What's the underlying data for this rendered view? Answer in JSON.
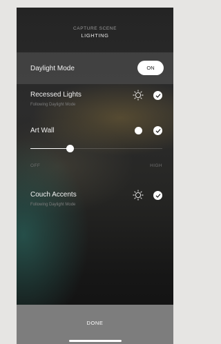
{
  "header": {
    "subtitle": "CAPTURE SCENE",
    "title": "LIGHTING"
  },
  "daylight_mode": {
    "label": "Daylight Mode",
    "toggle_label": "ON",
    "enabled": true
  },
  "lights": [
    {
      "label": "Recessed Lights",
      "sublabel": "Following Daylight Mode",
      "selected": true,
      "icon": "sun-icon"
    },
    {
      "label": "Art Wall",
      "sublabel": "",
      "selected": true,
      "icon": "white-dot"
    },
    {
      "label": "Couch Accents",
      "sublabel": "Following Daylight Mode",
      "selected": true,
      "icon": "sun-icon"
    }
  ],
  "slider": {
    "min_label": "OFF",
    "max_label": "HIGH",
    "level": 0.3
  },
  "footer": {
    "done_label": "DONE"
  },
  "colors": {
    "background": "#e6e5e3",
    "done_bar": "#7d7d7d",
    "accent": "#ffffff"
  }
}
